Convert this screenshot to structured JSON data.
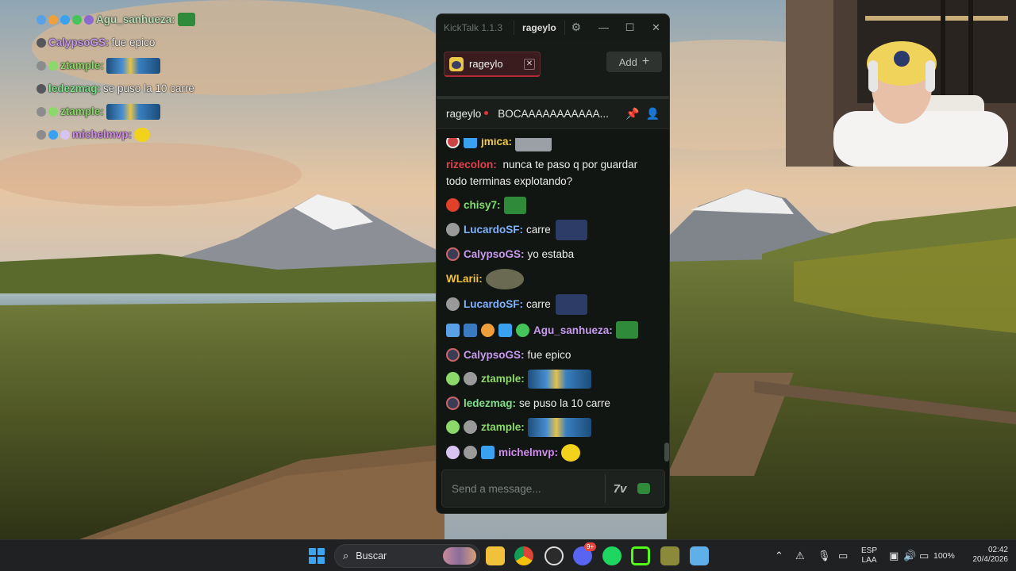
{
  "overlay": {
    "rows": [
      {
        "user": "Agu_sanhueza:",
        "user_color": "#b9e3b9",
        "message": ""
      },
      {
        "user": "CalypsoGS:",
        "user_color": "#c79af0",
        "message": "fue epico"
      },
      {
        "user": "ztample:",
        "user_color": "#8bd96a",
        "message": ""
      },
      {
        "user": "ledezmag:",
        "user_color": "#7fe08a",
        "message": "se puso la 10 carre"
      },
      {
        "user": "ztample:",
        "user_color": "#8bd96a",
        "message": ""
      },
      {
        "user": "michelmvp:",
        "user_color": "#d28bf0",
        "message": ""
      }
    ]
  },
  "window": {
    "app_name": "KickTalk 1.1.3",
    "user": "rageylo",
    "settings_icon": "gear-icon",
    "minimize_icon": "minimize-icon",
    "maximize_icon": "maximize-icon",
    "close_icon": "close-icon"
  },
  "tabs": {
    "items": [
      {
        "label": "rageylo"
      }
    ],
    "add_label": "Add"
  },
  "channel": {
    "name": "rageylo",
    "stream_title": "BOCAAAAAAAAAAA...",
    "live_color": "#d83a3a"
  },
  "chat": {
    "messages": [
      {
        "user": "jmica:",
        "color": "#f0c94a",
        "text": ""
      },
      {
        "user": "rizecolon:",
        "color": "#e0414a",
        "text": "nunca te paso q por guardar todo terminas explotando?"
      },
      {
        "user": "chisy7:",
        "color": "#7fe06a",
        "text": ""
      },
      {
        "user": "LucardoSF:",
        "color": "#7fb2ff",
        "text": "carre"
      },
      {
        "user": "CalypsoGS:",
        "color": "#c79af0",
        "text": "yo estaba"
      },
      {
        "user": "WLarii:",
        "color": "#f2c23a",
        "text": ""
      },
      {
        "user": "LucardoSF:",
        "color": "#7fb2ff",
        "text": "carre"
      },
      {
        "user": "Agu_sanhueza:",
        "color": "#c79af0",
        "text": ""
      },
      {
        "user": "CalypsoGS:",
        "color": "#c79af0",
        "text": "fue epico"
      },
      {
        "user": "ztample:",
        "color": "#8bd96a",
        "text": ""
      },
      {
        "user": "ledezmag:",
        "color": "#7fe08a",
        "text": "se puso la 10 carre"
      },
      {
        "user": "ztample:",
        "color": "#8bd96a",
        "text": ""
      },
      {
        "user": "michelmvp:",
        "color": "#d28bf0",
        "text": ""
      }
    ]
  },
  "input": {
    "placeholder": "Send a message...",
    "icons": [
      "seventv-icon",
      "emote-icon"
    ]
  },
  "taskbar": {
    "search_label": "Buscar",
    "apps": [
      "file-explorer-icon",
      "chrome-icon",
      "obs-icon",
      "discord-icon",
      "spotify-icon",
      "kick-icon",
      "game-icon",
      "notepad-icon"
    ],
    "discord_badge": "9+",
    "language_top": "ESP",
    "language_bottom": "LAA",
    "battery": "100%",
    "time": "02:42",
    "date": "20/4/2026"
  }
}
